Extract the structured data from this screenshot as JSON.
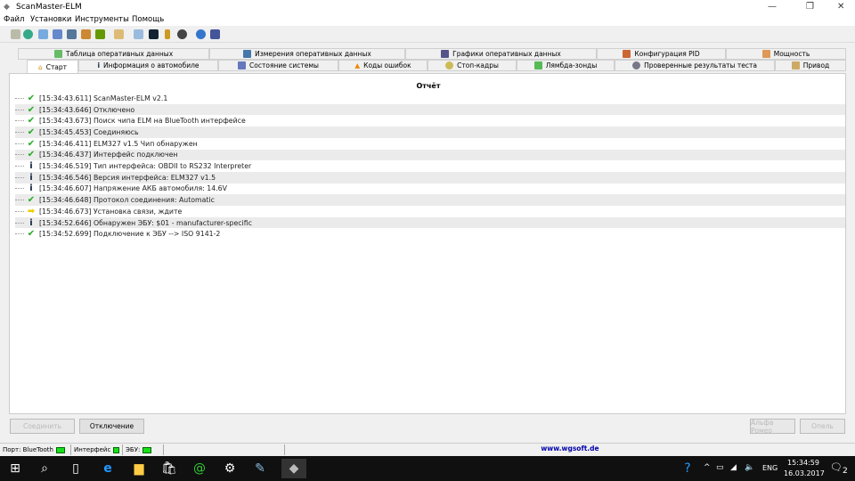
{
  "window": {
    "title": "ScanMaster-ELM"
  },
  "menu": [
    "Файл",
    "Установки",
    "Инструменты",
    "Помощь"
  ],
  "tabs_row1": [
    "Таблица оперативных данных",
    "Измерения оперативных данных",
    "Графики оперативных данных",
    "Конфигурация PID",
    "Мощность"
  ],
  "tabs_row2": [
    "Старт",
    "Информация о автомобиле",
    "Состояние системы",
    "Коды ошибок",
    "Стоп-кадры",
    "Лямбда-зонды",
    "Проверенные результаты теста",
    "Привод"
  ],
  "report": {
    "title": "Отчёт",
    "entries": [
      {
        "icon": "check",
        "text": "[15:34:43.611] ScanMaster-ELM v2.1"
      },
      {
        "icon": "check",
        "text": "[15:34:43.646] Отключено"
      },
      {
        "icon": "check",
        "text": "[15:34:43.673] Поиск чипа ELM на BlueTooth интерфейсе"
      },
      {
        "icon": "check",
        "text": "[15:34:45.453] Соединяюсь"
      },
      {
        "icon": "check",
        "text": "[15:34:46.411] ELM327 v1.5 Чип обнаружен"
      },
      {
        "icon": "check",
        "text": "[15:34:46.437] Интерфейс подключен"
      },
      {
        "icon": "info",
        "text": "[15:34:46.519] Тип интерфейса: OBDII to RS232 Interpreter"
      },
      {
        "icon": "info",
        "text": "[15:34:46.546] Версия интерфейса: ELM327 v1.5"
      },
      {
        "icon": "info",
        "text": "[15:34:46.607] Напряжение АКБ автомобиля: 14.6V"
      },
      {
        "icon": "check",
        "text": "[15:34:46.648] Протокол соединения: Automatic"
      },
      {
        "icon": "arrow",
        "text": "[15:34:46.673] Установка связи, ждите"
      },
      {
        "icon": "info",
        "text": "[15:34:52.646] Обнаружен ЭБУ: $01 - manufacturer-specific"
      },
      {
        "icon": "check",
        "text": "[15:34:52.699] Подключение к ЭБУ --> ISO 9141-2"
      }
    ]
  },
  "buttons": {
    "connect": "Соединить",
    "disconnect": "Отключение",
    "alfa": "Альфа Ромео",
    "opel": "Опель"
  },
  "status": {
    "port": "Порт: BlueTooth",
    "interface": "Интерфейс",
    "ecu": "ЭБУ:",
    "site": "www.wgsoft.de"
  },
  "taskbar": {
    "lang": "ENG",
    "time": "15:34:59",
    "date": "16.03.2017",
    "notifications": "2"
  }
}
